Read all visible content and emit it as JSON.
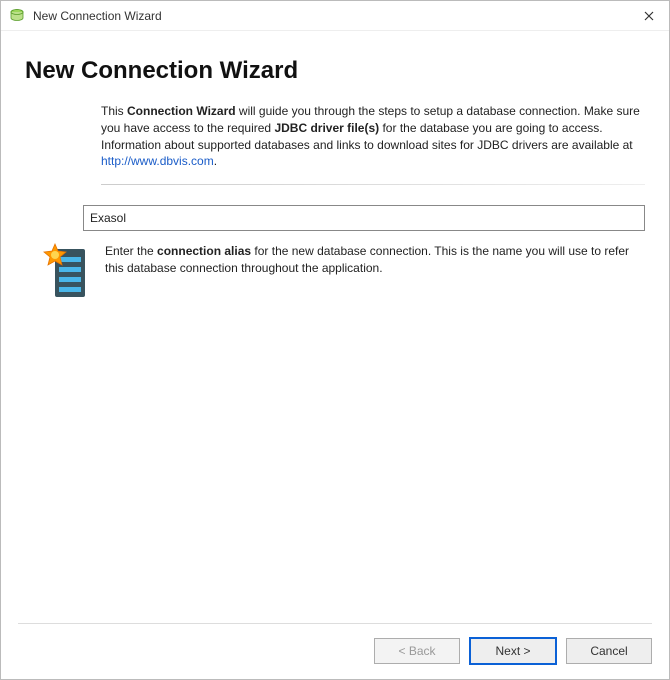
{
  "window": {
    "title": "New Connection Wizard"
  },
  "heading": "New Connection Wizard",
  "intro": {
    "prefix": "This ",
    "bold1": "Connection Wizard",
    "mid1": " will guide you through the steps to setup a database connection. Make sure you have access to the required ",
    "bold2": "JDBC driver file(s)",
    "mid2": " for the database you are going to access.",
    "line2a": "Information about supported databases and links to download sites for JDBC drivers are available at ",
    "link": "http://www.dbvis.com",
    "line2b": "."
  },
  "alias": {
    "value": "Exasol",
    "hint_prefix": "Enter the ",
    "hint_bold": "connection alias",
    "hint_suffix": " for the new database connection. This is the name you will use to refer this database connection throughout the application."
  },
  "buttons": {
    "back": "< Back",
    "next": "Next >",
    "cancel": "Cancel"
  }
}
